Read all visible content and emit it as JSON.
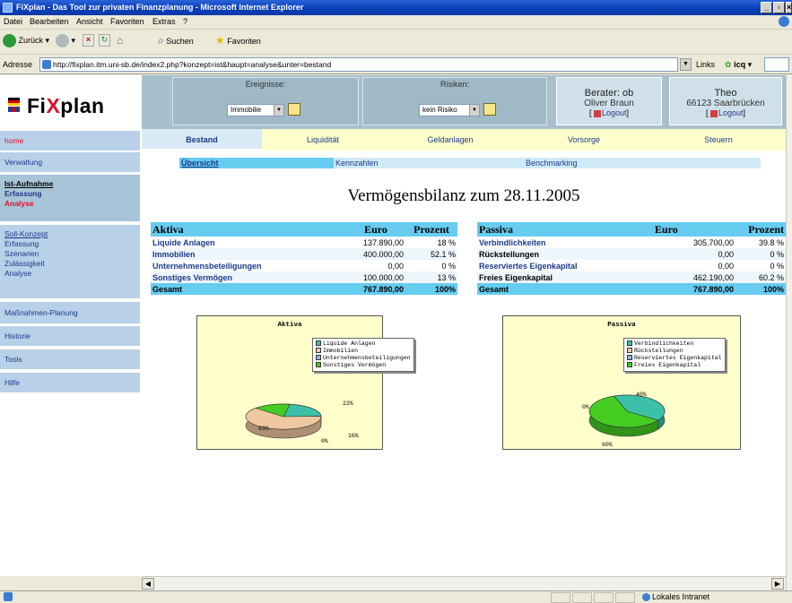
{
  "browser": {
    "title": "FiXplan - Das Tool zur privaten Finanzplanung - Microsoft Internet Explorer",
    "menu": [
      "Datei",
      "Bearbeiten",
      "Ansicht",
      "Favoriten",
      "Extras",
      "?"
    ],
    "toolbar": {
      "back": "Zurück",
      "search": "Suchen",
      "favorites": "Favoriten"
    },
    "address_label": "Adresse",
    "url": "http://fixplan.itm.uni-sb.de/index2.php?konzept=ist&haupt=analyse&unter=bestand",
    "links_label": "Links",
    "icq_label": "icq",
    "status_zone": "Lokales Intranet"
  },
  "app": {
    "brand_pre": "Fi",
    "brand_x": "X",
    "brand_post": "plan",
    "ereignisse_label": "Ereignisse:",
    "ereignisse_value": "Immobilie",
    "risiken_label": "Risiken:",
    "risiken_value": "kein Risiko",
    "berater_title": "Berater: ob",
    "berater_name": "Oliver Braun",
    "berater_logout": "Logout",
    "client_name": "Theo",
    "client_city": "66123 Saarbrücken",
    "client_logout": "Logout"
  },
  "sidebar": {
    "home": "home",
    "verwaltung": "Verwaltung",
    "ist_heading": "Ist-Aufnahme",
    "ist_erfassung": "Erfassung",
    "ist_analyse": "Analyse",
    "soll_heading": "Soll-Konzept",
    "soll_items": [
      "Erfassung",
      "Szenarien",
      "Zulässigkeit",
      "Analyse"
    ],
    "massnahmen": "Maßnahmen-Planung",
    "historie": "Historie",
    "tools": "Tools",
    "hilfe": "Hilfe"
  },
  "tabs": [
    "Bestand",
    "Liquidität",
    "Geldanlagen",
    "Vorsorge",
    "Steuern"
  ],
  "subtabs": [
    "Übersicht",
    "Kennzahlen",
    "Benchmarking"
  ],
  "page_title": "Vermögensbilanz zum 28.11.2005",
  "aktiva": {
    "headers": [
      "Aktiva",
      "Euro",
      "Prozent"
    ],
    "rows": [
      {
        "label": "Liquide Anlagen",
        "euro": "137.890,00",
        "pct": "18 %"
      },
      {
        "label": "Immobilien",
        "euro": "400.000,00",
        "pct": "52.1 %"
      },
      {
        "label": "Unternehmensbeteiligungen",
        "euro": "0,00",
        "pct": "0 %"
      },
      {
        "label": "Sonstiges Vermögen",
        "euro": "100.000,00",
        "pct": "13 %"
      }
    ],
    "total": {
      "label": "Gesamt",
      "euro": "767.890,00",
      "pct": "100%"
    }
  },
  "passiva": {
    "headers": [
      "Passiva",
      "Euro",
      "Prozent"
    ],
    "rows": [
      {
        "label": "Verbindlichkeiten",
        "euro": "305.700,00",
        "pct": "39.8 %"
      },
      {
        "label": "Rückstellungen",
        "euro": "0,00",
        "pct": "0 %"
      },
      {
        "label": "Reserviertes Eigenkapital",
        "euro": "0,00",
        "pct": "0 %"
      },
      {
        "label": "Freies Eigenkapital",
        "euro": "462.190,00",
        "pct": "60.2 %"
      }
    ],
    "total": {
      "label": "Gesamt",
      "euro": "767.890,00",
      "pct": "100%"
    }
  },
  "chart_data": [
    {
      "type": "pie",
      "title": "Aktiva",
      "categories": [
        "Liquide Anlagen",
        "Immobilien",
        "Unternehmensbeteiligungen",
        "Sonstiges Vermögen"
      ],
      "values": [
        22,
        63,
        0,
        16
      ],
      "value_labels": [
        "22%",
        "63%",
        "0%",
        "16%"
      ],
      "colors": [
        "#3cc0a8",
        "#f0c8a0",
        "#88b8e0",
        "#44cc22"
      ]
    },
    {
      "type": "pie",
      "title": "Passiva",
      "categories": [
        "Verbindlichkeiten",
        "Rückstellungen",
        "Reserviertes Eigenkapital",
        "Freies Eigenkapital"
      ],
      "values": [
        40,
        0,
        0,
        60
      ],
      "value_labels": [
        "40%",
        "0%",
        "0%",
        "60%"
      ],
      "colors": [
        "#3cc0a8",
        "#f0c8a0",
        "#88b8e0",
        "#44cc22"
      ]
    }
  ]
}
